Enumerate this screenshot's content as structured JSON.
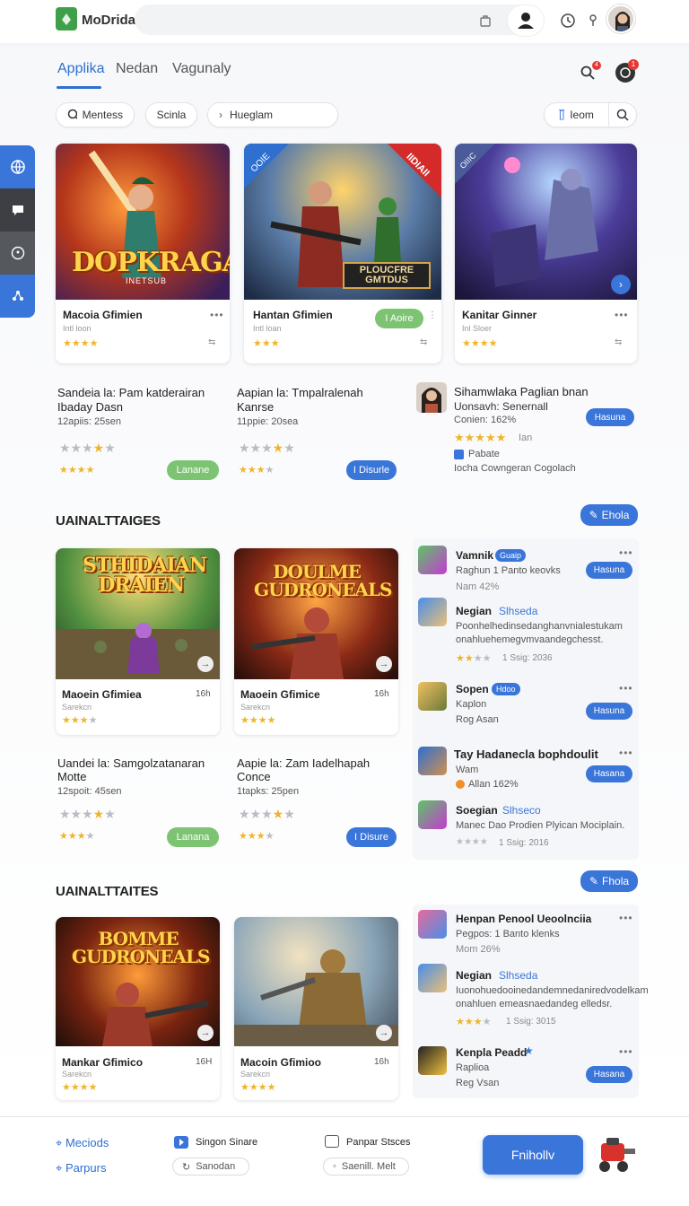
{
  "app": {
    "title": "MoDrida"
  },
  "tabs": [
    "Applika",
    "Nedan",
    "Vagunaly"
  ],
  "filters": {
    "chip1": "Mentess",
    "chip2": "Scinla",
    "search_placeholder": "Hueglam",
    "room": "Ieom"
  },
  "badges": {
    "notif_count": "4",
    "alert_count": "1"
  },
  "featured": [
    {
      "title": "Macoia Gfimien",
      "sub": "Intl loon",
      "rating": "★★★★",
      "art": "DOPKRAGAI",
      "art_sub": "INETSUB"
    },
    {
      "title": "Hantan Gfimien",
      "sub": "Intl loan",
      "rating": "★★★",
      "button": "I Aoire",
      "art": "PLOUCFRE GMTDUS",
      "ribbon_left": "OOIE",
      "ribbon_right": "IIDIAII"
    },
    {
      "title": "Kanitar Ginner",
      "sub": "Inl Sloer",
      "rating": "★★★★",
      "ribbon_left": "OIIIC"
    }
  ],
  "promos": [
    {
      "line1": "Sandeia la: Pam katderairan",
      "line2": "Ibaday Dasn",
      "meta": "12apiis: 25sen",
      "button": "Lanane"
    },
    {
      "line1": "Aapian la: Tmpalralenah",
      "line2": "Kanrse",
      "meta": "11ppie: 20sea",
      "button": "I Disurle"
    },
    {
      "line1": "Sihamwlaka Paglian bnan",
      "line2": "Uonsavh: Senernall",
      "meta": "Conien: 162%",
      "button": "Hasuna",
      "extra1": "Ian",
      "extra2": "Pabate",
      "extra3": "Iocha Cowngeran Cogolach"
    }
  ],
  "sections": [
    {
      "heading": "UAINALTTAIGES",
      "button": "Ehola"
    },
    {
      "heading": "UAINALTTAITES",
      "button": "Fhola"
    }
  ],
  "grid1": [
    {
      "title": "Maoein Gfimiea",
      "sub": "Sarekcn",
      "tag": "16h",
      "art": "STHIDAIAN DRAIEN"
    },
    {
      "title": "Maoein Gfimice",
      "sub": "Sarekcn",
      "tag": "16h",
      "art": "DOULME GUDRONEALS"
    }
  ],
  "promos2": [
    {
      "line1": "Uandei la: Samgolzatanaran",
      "line2": "Motte",
      "meta": "12spoit: 45sen",
      "button": "Lanana"
    },
    {
      "line1": "Aapie la: Zam Iadelhapah",
      "line2": "Conce",
      "meta": "1tapks: 25pen",
      "button": "I Disure"
    }
  ],
  "list1": [
    {
      "name": "Vamnik",
      "tag": "Guaip",
      "desc": "Raghun 1 Panto keovks",
      "meta": "Nam 42%",
      "button": "Hasuna"
    },
    {
      "name": "Negian",
      "tag": "Slhseda",
      "desc": "Poonhelhedinsedanghanvnialestukam",
      "desc2": "onahluehemegvmvaandegchesst.",
      "meta": "1 Ssig: 2036"
    },
    {
      "name": "Sopen",
      "tag": "Hdoo",
      "desc": "Kaplon",
      "meta": "Rog Asan",
      "button": "Hasuna"
    },
    {
      "name": "Tay Hadanecla bophdoulit",
      "tag": "Wam",
      "meta": "Allan 162%",
      "button": "Hasana"
    },
    {
      "name": "Soegian",
      "tag": "Slhseco",
      "desc": "Manec Dao Prodien Plyican Mociplain.",
      "meta": "1 Ssig: 2016"
    }
  ],
  "grid2": [
    {
      "title": "Mankar Gfimico",
      "sub": "Sarekcn",
      "tag": "16H",
      "art": "BOMME GUDRONEALS"
    },
    {
      "title": "Macoin Gfimioo",
      "sub": "Sarekcn",
      "tag": "16h"
    }
  ],
  "list2": [
    {
      "name": "Henpan Penool Ueoolnciia",
      "desc": "Pegpos: 1 Banto klenks",
      "meta": "Mom 26%"
    },
    {
      "name": "Negian",
      "tag": "Slhseda",
      "desc": "Iuonohuedooinedandemnedaniredvodelkam",
      "desc2": "onahluen emeasnaedandeg elledsr.",
      "meta": "1 Ssig: 3015"
    },
    {
      "name": "Kenpla Peadd",
      "desc": "Raplioa",
      "meta": "Reg Vsan",
      "button": "Hasana"
    }
  ],
  "footer": {
    "link1": "Meciods",
    "link2": "Parpurs",
    "item1": "Singon Sinare",
    "pill1": "Sanodan",
    "item2": "Panpar Stsces",
    "pill2": "Saenill. Melt",
    "cta": "Fnihollv"
  },
  "colors": {
    "accent": "#3a75d9",
    "green": "#7cc472",
    "star": "#f0b429",
    "sidebar": "#3a75d9"
  }
}
